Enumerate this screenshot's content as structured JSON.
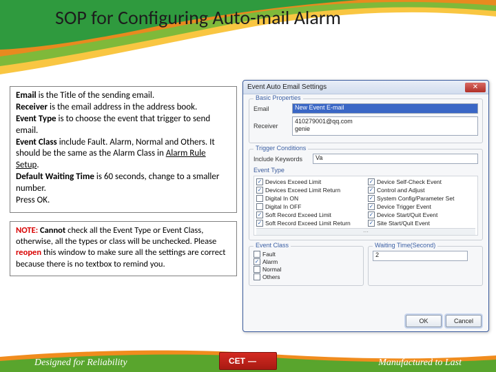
{
  "slide": {
    "title": "SOP for Configuring Auto-mail Alarm"
  },
  "desc": {
    "email_label": "Email",
    "email_rest": " is the Title of the sending email.",
    "receiver_label": "Receiver",
    "receiver_rest": " is the email address in the address book.",
    "eventtype_label": "Event Type",
    "eventtype_rest": " is to choose the event that trigger to send email.",
    "eventclass_label": "Event Class",
    "eventclass_text1": " include Fault. Alarm, Normal and Others. It should be the same as the Alarm Class in ",
    "alarmrule": "Alarm Rule Setup",
    "period": ".",
    "defwait_label": "Default Waiting Time",
    "defwait_rest": " is 60 seconds, change to a smaller number.",
    "pressok": "Press OK."
  },
  "note": {
    "label": "NOTE:",
    "cannot": "Cannot",
    "text1": " check all the Event Type or Event Class, otherwise, all the types or class will be unchecked. Please ",
    "reopen": "reopen",
    "text2": " this window to make sure all the settings are correct because there is no textbox to remind you."
  },
  "dialog": {
    "title": "Event Auto Email Settings",
    "group_basic": "Basic Properties",
    "lbl_email": "Email",
    "val_email": "New Event E-mail",
    "lbl_receiver": "Receiver",
    "val_receiver": "410279001@qq.com\ngenie",
    "group_trigger": "Trigger Conditions",
    "lbl_keywords": "Include Keywords",
    "val_keywords": "Va",
    "lbl_eventtype": "Event Type",
    "check_items": [
      {
        "label": "Devices Exceed Limit",
        "checked": true
      },
      {
        "label": "Device Self-Check Event",
        "checked": true
      },
      {
        "label": "Devices Exceed Limit Return",
        "checked": true
      },
      {
        "label": "Control and Adjust",
        "checked": true
      },
      {
        "label": "Digital In ON",
        "checked": false
      },
      {
        "label": "System Config/Parameter Set",
        "checked": true
      },
      {
        "label": "Digital In OFF",
        "checked": false
      },
      {
        "label": "Device Trigger Event",
        "checked": true
      },
      {
        "label": "Soft Record Exceed Limit",
        "checked": true
      },
      {
        "label": "Device Start/Quit Event",
        "checked": true
      },
      {
        "label": "Soft Record Exceed Limit Return",
        "checked": true
      },
      {
        "label": "Site Start/Quit Event",
        "checked": true
      }
    ],
    "group_eventclass": "Event Class",
    "class_items": [
      {
        "label": "Fault",
        "checked": false
      },
      {
        "label": "Alarm",
        "checked": true
      },
      {
        "label": "Normal",
        "checked": false
      },
      {
        "label": "Others",
        "checked": false
      }
    ],
    "group_wait": "Waiting Time(Second)",
    "val_wait": "2",
    "btn_ok": "OK",
    "btn_cancel": "Cancel"
  },
  "footer": {
    "left": "Designed for Reliability",
    "right": "Manufactured to Last",
    "logo": "CET"
  }
}
